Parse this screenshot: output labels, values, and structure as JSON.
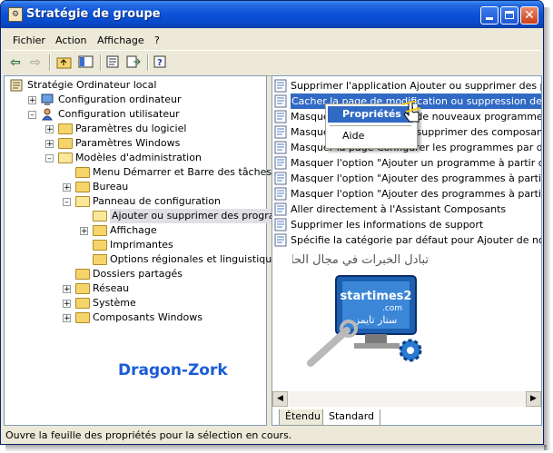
{
  "window": {
    "title": "Stratégie de groupe",
    "title_icon": "gpedit-icon"
  },
  "menubar": {
    "items": [
      "Fichier",
      "Action",
      "Affichage",
      "?"
    ]
  },
  "toolbar": {
    "icons": [
      "back-icon",
      "forward-icon",
      "up-folder-icon",
      "show-tree-icon",
      "properties-icon",
      "export-icon",
      "help-icon"
    ]
  },
  "tree": {
    "items": [
      {
        "label": "Stratégie Ordinateur local",
        "level": 0,
        "expander": ""
      },
      {
        "label": "Configuration ordinateur",
        "level": 1,
        "expander": "+"
      },
      {
        "label": "Configuration utilisateur",
        "level": 1,
        "expander": "-"
      },
      {
        "label": "Paramètres du logiciel",
        "level": 2,
        "expander": "+"
      },
      {
        "label": "Paramètres Windows",
        "level": 2,
        "expander": "+"
      },
      {
        "label": "Modèles d'administration",
        "level": 2,
        "expander": "-"
      },
      {
        "label": "Menu Démarrer et Barre des tâches",
        "level": 3,
        "expander": ""
      },
      {
        "label": "Bureau",
        "level": 3,
        "expander": "+"
      },
      {
        "label": "Panneau de configuration",
        "level": 3,
        "expander": "-"
      },
      {
        "label": "Ajouter ou supprimer des programmes",
        "level": 4,
        "expander": ""
      },
      {
        "label": "Affichage",
        "level": 4,
        "expander": "+"
      },
      {
        "label": "Imprimantes",
        "level": 4,
        "expander": ""
      },
      {
        "label": "Options régionales et linguistiques",
        "level": 4,
        "expander": ""
      },
      {
        "label": "Dossiers partagés",
        "level": 3,
        "expander": ""
      },
      {
        "label": "Réseau",
        "level": 3,
        "expander": "+"
      },
      {
        "label": "Système",
        "level": 3,
        "expander": "+"
      },
      {
        "label": "Composants Windows",
        "level": 3,
        "expander": "+"
      }
    ]
  },
  "list": {
    "items": [
      "Supprimer l'application Ajouter ou supprimer des programmes",
      "Cacher la page de modification ou suppression des programmes",
      "Masquer la page Ajouter de nouveaux programmes",
      "Masquer la page Ajouter/supprimer des composants Windows",
      "Masquer la page Configurer les programmes par défaut",
      "Masquer l'option \"Ajouter un programme à partir d'un CD-ROM",
      "Masquer l'option \"Ajouter des programmes à partir de Microsoft\"",
      "Masquer l'option \"Ajouter des programmes à partir de votre réseau\"",
      "Aller directement à l'Assistant Composants",
      "Supprimer les informations de support",
      "Spécifie la catégorie par défaut pour Ajouter de nouveaux programmes"
    ]
  },
  "context_menu": {
    "items": [
      "Propriétés",
      "Aide"
    ]
  },
  "tabs": {
    "items": [
      "Étendu",
      "Standard"
    ],
    "active": "Standard"
  },
  "status": {
    "text": "Ouvre la feuille des propriétés pour la sélection en cours."
  },
  "overlay": {
    "watermark": "Dragon-Zork",
    "arabic_text": "تبادل الخبرات في مجال الحاسب",
    "logo_text": "startimes2",
    "logo_sub": ".com",
    "logo_arabic": "ستار تايمز"
  },
  "colors": {
    "titlebar": "#0a52d8",
    "selection": "#316ac5",
    "watermark": "#1a5bd8",
    "frame": "#ece9d8"
  }
}
